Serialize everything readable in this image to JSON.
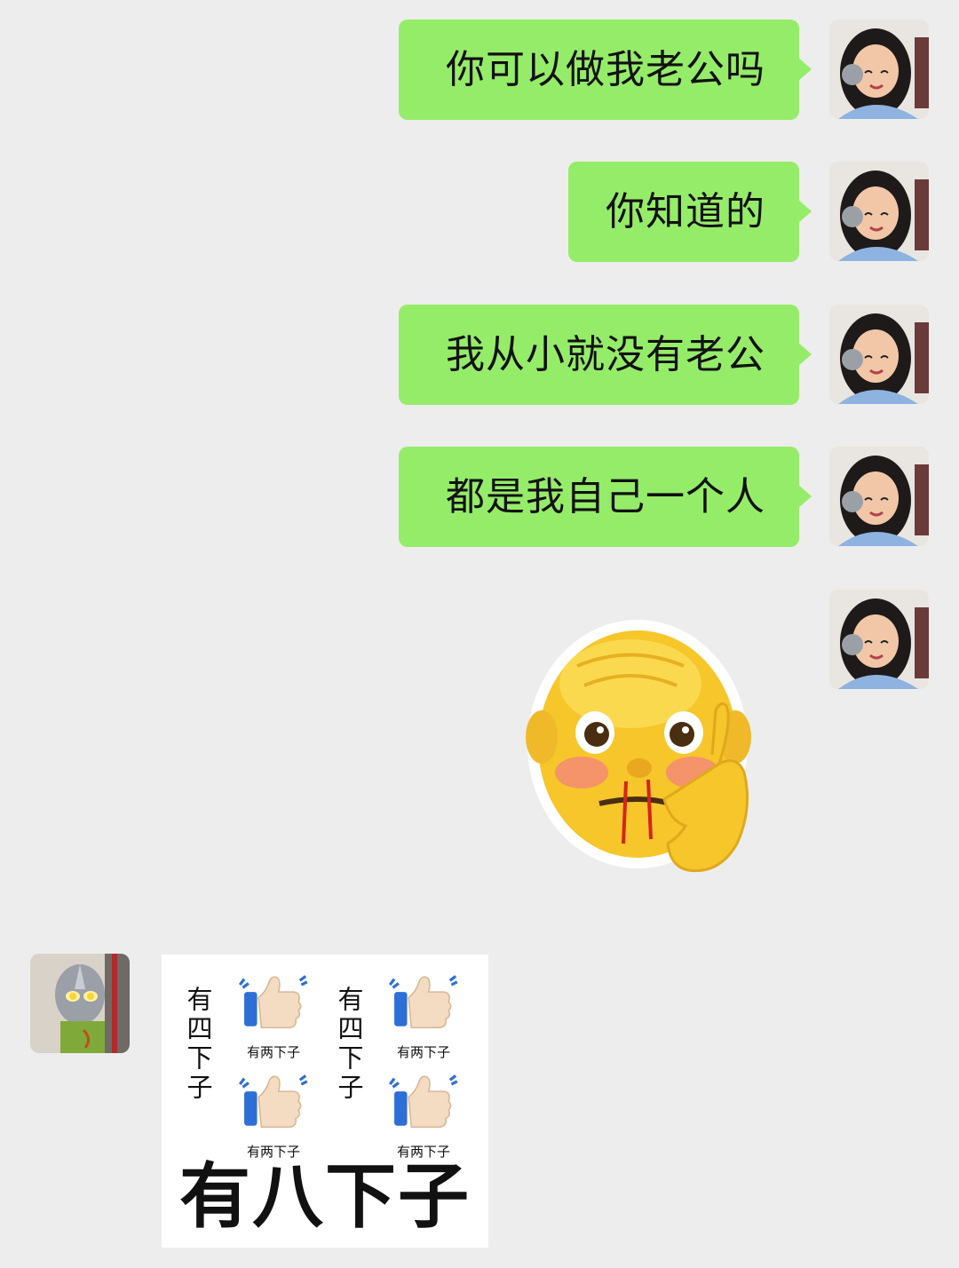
{
  "messages": [
    {
      "text": "你可以做我老公吗"
    },
    {
      "text": "你知道的"
    },
    {
      "text": "我从小就没有老公"
    },
    {
      "text": "都是我自己一个人"
    }
  ],
  "colors": {
    "background": "#ededed",
    "sent_bubble": "#95ec69",
    "text": "#111111"
  },
  "sent_sticker": {
    "icon": "old-man-nosebleed-emoji-icon"
  },
  "received_sticker": {
    "vertical_text": "有四下子",
    "thumb_caption": "有两下子",
    "big_caption": "有八下子",
    "icon": "thumbs-up-icon"
  }
}
